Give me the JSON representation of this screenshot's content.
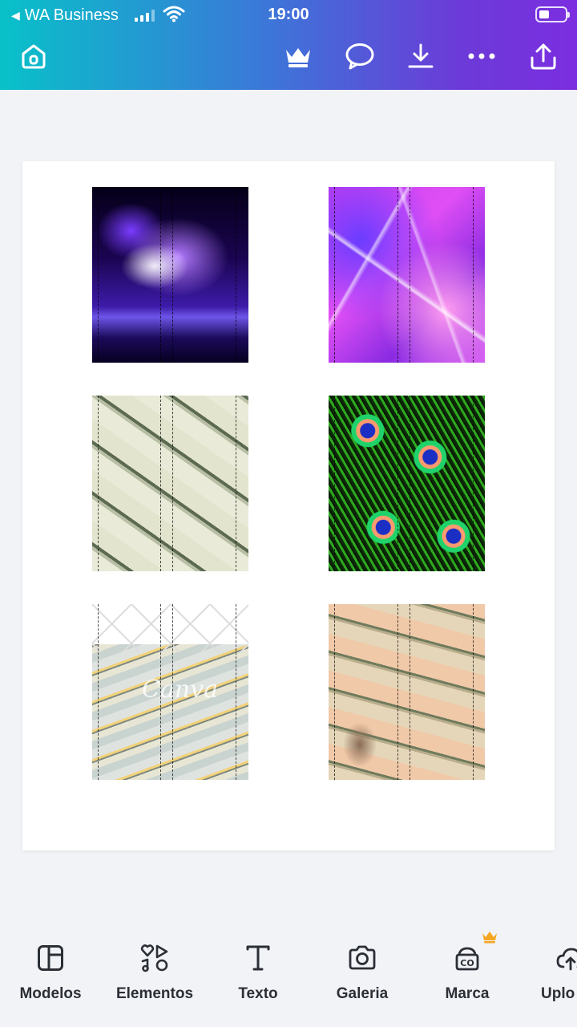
{
  "status_bar": {
    "back_app": "WA Business",
    "time": "19:00"
  },
  "toolbar": {
    "home_icon": "home-icon",
    "icons": [
      "crown-icon",
      "comment-icon",
      "download-icon",
      "more-icon",
      "share-icon"
    ]
  },
  "canvas": {
    "tiles": [
      {
        "name": "purple-flame-image",
        "column": 1,
        "row": 1
      },
      {
        "name": "pink-crystal-image",
        "column": 2,
        "row": 1
      },
      {
        "name": "dollar-stacks-image",
        "column": 1,
        "row": 2
      },
      {
        "name": "peacock-feathers-image",
        "column": 2,
        "row": 2
      },
      {
        "name": "cash-bundles-image",
        "column": 1,
        "row": 3,
        "watermark": "Canva"
      },
      {
        "name": "hundred-dollar-bills-image",
        "column": 2,
        "row": 3
      }
    ]
  },
  "bottom_nav": {
    "items": [
      {
        "label": "Modelos",
        "icon": "templates-icon"
      },
      {
        "label": "Elementos",
        "icon": "elements-icon"
      },
      {
        "label": "Texto",
        "icon": "text-icon"
      },
      {
        "label": "Galeria",
        "icon": "camera-icon"
      },
      {
        "label": "Marca",
        "icon": "brand-icon",
        "premium": true
      },
      {
        "label": "Uplo",
        "icon": "upload-icon"
      }
    ]
  },
  "colors": {
    "header_gradient_start": "#08c1c9",
    "header_gradient_end": "#7b2ee0",
    "premium_crown": "#f5a623",
    "nav_text": "#2b2f36"
  }
}
